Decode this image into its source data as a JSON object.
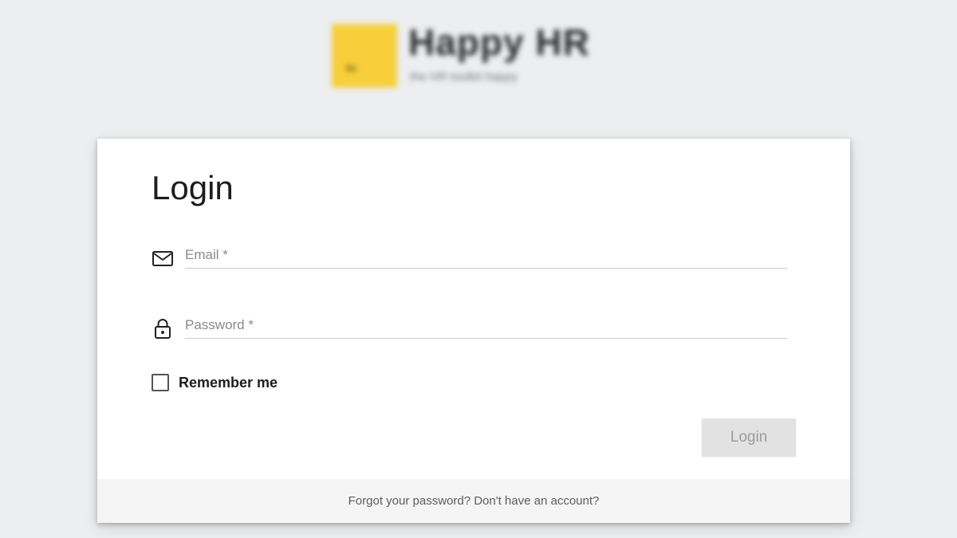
{
  "brand": {
    "mark_text": "hr",
    "name": "Happy HR",
    "tagline": "the HR toolkit happy"
  },
  "login": {
    "title": "Login",
    "email": {
      "placeholder": "Email *",
      "value": "",
      "icon": "envelope-icon"
    },
    "password": {
      "placeholder": "Password *",
      "value": "",
      "icon": "lock-icon"
    },
    "remember_label": "Remember me",
    "remember_checked": false,
    "submit_label": "Login",
    "footer_link": "Forgot your password? Don't have an account?"
  },
  "colors": {
    "background": "#eceef0",
    "card": "#ffffff",
    "brand_yellow": "#f6cf3a",
    "button_disabled_bg": "#e2e2e2",
    "button_disabled_text": "#9c9c9c",
    "footer_bg": "#f5f5f5"
  }
}
